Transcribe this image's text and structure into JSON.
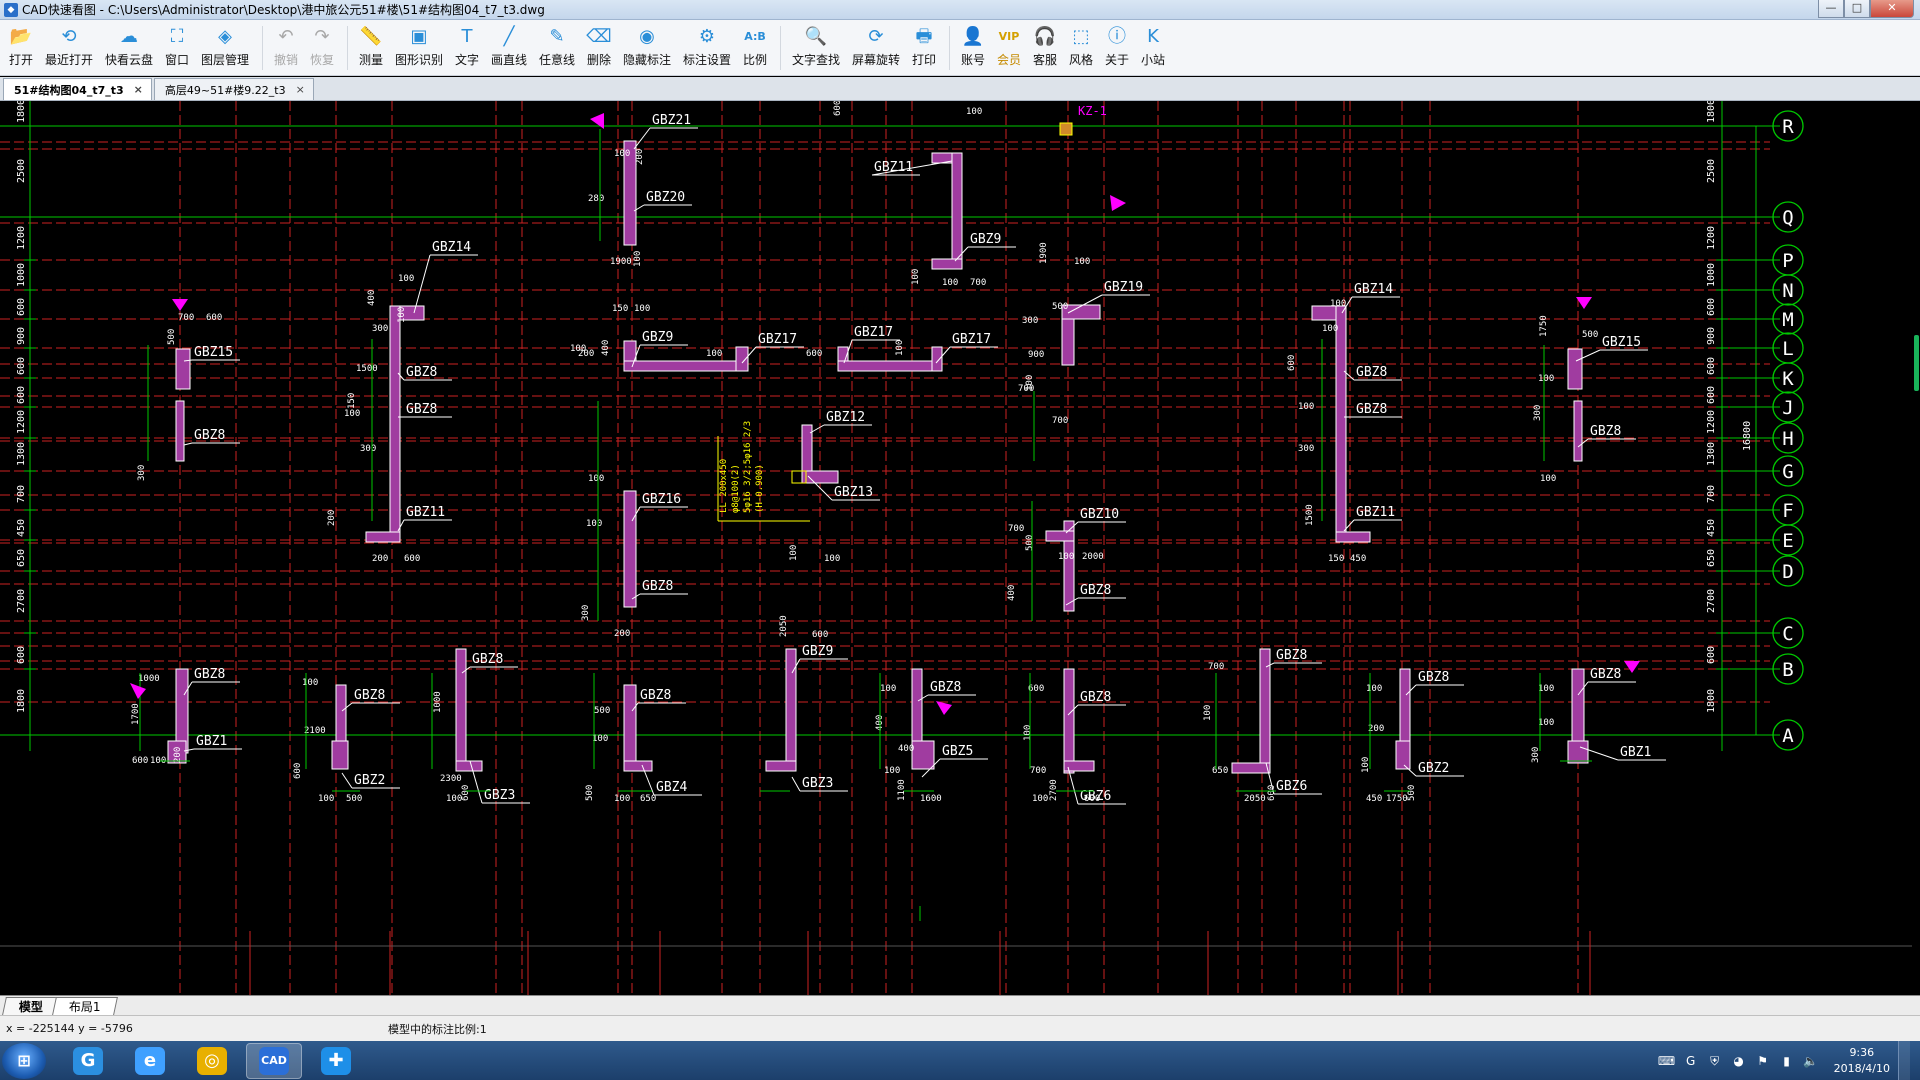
{
  "window": {
    "app_name": "CAD快速看图",
    "path": "C:\\Users\\Administrator\\Desktop\\港中旅公元51#楼\\51#结构图04_t7_t3.dwg",
    "minimize": "—",
    "maximize": "□",
    "close": "✕"
  },
  "toolbar": {
    "items": [
      {
        "label": "打开",
        "icon": "folder-open-icon",
        "glyph": "📂",
        "enabled": true
      },
      {
        "label": "最近打开",
        "icon": "history-icon",
        "glyph": "⟲",
        "enabled": true
      },
      {
        "label": "快看云盘",
        "icon": "cloud-icon",
        "glyph": "☁",
        "enabled": true
      },
      {
        "label": "窗口",
        "icon": "window-icon",
        "glyph": "⛶",
        "enabled": true
      },
      {
        "label": "图层管理",
        "icon": "layers-icon",
        "glyph": "◈",
        "enabled": true
      },
      {
        "label": "撤销",
        "icon": "undo-icon",
        "glyph": "↶",
        "enabled": false
      },
      {
        "label": "恢复",
        "icon": "redo-icon",
        "glyph": "↷",
        "enabled": false
      },
      {
        "label": "测量",
        "icon": "measure-icon",
        "glyph": "📏",
        "enabled": true
      },
      {
        "label": "图形识别",
        "icon": "shape-recognize-icon",
        "glyph": "▣",
        "enabled": true
      },
      {
        "label": "文字",
        "icon": "text-icon",
        "glyph": "T",
        "enabled": true
      },
      {
        "label": "画直线",
        "icon": "line-icon",
        "glyph": "╱",
        "enabled": true
      },
      {
        "label": "任意线",
        "icon": "freehand-icon",
        "glyph": "✎",
        "enabled": true
      },
      {
        "label": "删除",
        "icon": "eraser-icon",
        "glyph": "⌫",
        "enabled": true
      },
      {
        "label": "隐藏标注",
        "icon": "eye-hide-icon",
        "glyph": "◉",
        "enabled": true
      },
      {
        "label": "标注设置",
        "icon": "annotation-settings-icon",
        "glyph": "⚙",
        "enabled": true
      },
      {
        "label": "比例",
        "icon": "scale-icon",
        "glyph": "A:B",
        "enabled": true
      },
      {
        "label": "文字查找",
        "icon": "text-search-icon",
        "glyph": "🔍",
        "enabled": true
      },
      {
        "label": "屏幕旋转",
        "icon": "rotate-screen-icon",
        "glyph": "⟳",
        "enabled": true
      },
      {
        "label": "打印",
        "icon": "print-icon",
        "glyph": "🖶",
        "enabled": true
      },
      {
        "label": "账号",
        "icon": "account-icon",
        "glyph": "👤",
        "enabled": true
      },
      {
        "label": "会员",
        "icon": "vip-icon",
        "glyph": "VIP",
        "enabled": true,
        "vip": true
      },
      {
        "label": "客服",
        "icon": "headset-icon",
        "glyph": "🎧",
        "enabled": true
      },
      {
        "label": "风格",
        "icon": "style-icon",
        "glyph": "⬚",
        "enabled": true
      },
      {
        "label": "关于",
        "icon": "info-icon",
        "glyph": "ⓘ",
        "enabled": true
      },
      {
        "label": "小站",
        "icon": "station-icon",
        "glyph": "K",
        "enabled": true
      }
    ]
  },
  "tabs": [
    {
      "label": "51#结构图04_t7_t3",
      "active": true,
      "close": "×"
    },
    {
      "label": "高层49~51#楼9.22_t3",
      "active": false,
      "close": "×"
    }
  ],
  "layout_tabs": [
    {
      "label": "模型",
      "active": true
    },
    {
      "label": "布局1",
      "active": false
    }
  ],
  "status": {
    "coords": "x = -225144  y = -5796",
    "annotation_scale": "模型中的标注比例:1"
  },
  "taskbar": {
    "time": "9:36",
    "date": "2018/4/10",
    "apps": [
      {
        "name": "G",
        "icon": "g-app-icon",
        "color": "#2b8fe0",
        "active": false
      },
      {
        "name": "e",
        "icon": "ie-icon",
        "color": "#3fa0ff",
        "active": false
      },
      {
        "name": "◎",
        "icon": "chrome-icon",
        "color": "#e8b000",
        "active": false
      },
      {
        "name": "CAD",
        "icon": "cad-viewer-icon",
        "color": "#2b6fd8",
        "active": true
      },
      {
        "name": "✚",
        "icon": "app-plus-icon",
        "color": "#1e8fe8",
        "active": false
      }
    ]
  },
  "colors": {
    "canvas_bg": "#000000",
    "grid_line": "#cc2222",
    "axis_line": "#00c800",
    "wall": "#a03ca0",
    "wall_edge": "#ffffff",
    "marker": "#ff00ff",
    "label": "#ffffff",
    "dim_text": "#ffffff",
    "annotation": "#ffff00"
  },
  "drawing": {
    "axis_labels": [
      "R",
      "Q",
      "P",
      "N",
      "M",
      "L",
      "K",
      "J",
      "H",
      "G",
      "F",
      "E",
      "D",
      "C",
      "B",
      "A"
    ],
    "left_dims": [
      "1800",
      "2500",
      "1200",
      "1000",
      "600",
      "900",
      "600",
      "600",
      "1200",
      "1300",
      "700",
      "450",
      "650",
      "2700",
      "600",
      "1800"
    ],
    "right_dims": [
      "1800",
      "2500",
      "1200",
      "1000",
      "600",
      "900",
      "600",
      "600",
      "1200",
      "1300",
      "700",
      "450",
      "650",
      "2700",
      "600",
      "1800"
    ],
    "right_total": "16800",
    "kz_label": "KZ-1",
    "beam_note": [
      "LL 200x450",
      "φ8@100(2)",
      "5φ16 3/2;5φ16 2/3",
      "(H-0.900)"
    ],
    "wall_labels": [
      "GBZ21",
      "GBZ20",
      "GBZ11",
      "GBZ9",
      "GBZ14",
      "GBZ15",
      "GBZ8",
      "GBZ8",
      "GBZ11",
      "GBZ8",
      "GBZ9",
      "GBZ17",
      "GBZ17",
      "GBZ17",
      "GBZ19",
      "GBZ12",
      "GBZ13",
      "GBZ16",
      "GBZ8",
      "GBZ10",
      "GBZ8",
      "GBZ14",
      "GBZ8",
      "GBZ8",
      "GBZ11",
      "GBZ15",
      "GBZ8",
      "GBZ8",
      "GBZ1",
      "GBZ8",
      "GBZ2",
      "GBZ8",
      "GBZ3",
      "GBZ8",
      "GBZ4",
      "GBZ9",
      "GBZ3",
      "GBZ8",
      "GBZ5",
      "GBZ8",
      "GBZ6",
      "GBZ8",
      "GBZ6",
      "GBZ8",
      "GBZ2",
      "GBZ8",
      "GBZ1"
    ],
    "dims": [
      "600",
      "100",
      "100",
      "200",
      "280",
      "1900",
      "100",
      "150",
      "100",
      "100",
      "100",
      "700",
      "400",
      "100",
      "300",
      "100",
      "100",
      "700",
      "500",
      "600",
      "1500",
      "150",
      "300",
      "100",
      "200",
      "200",
      "600",
      "300",
      "100",
      "100",
      "300",
      "200",
      "200",
      "400",
      "100",
      "600",
      "100",
      "300",
      "900",
      "1900",
      "100",
      "500",
      "100",
      "700",
      "700",
      "100",
      "100",
      "700",
      "500",
      "100",
      "2000",
      "400",
      "100",
      "100",
      "600",
      "100",
      "300",
      "1500",
      "150",
      "450",
      "1750",
      "500",
      "100",
      "300",
      "100",
      "1000",
      "1700",
      "600",
      "100",
      "200",
      "100",
      "2100",
      "600",
      "100",
      "500",
      "1000",
      "2300",
      "100",
      "600",
      "500",
      "100",
      "500",
      "100",
      "650",
      "2050",
      "600",
      "100",
      "400",
      "100",
      "400",
      "1100",
      "1600",
      "600",
      "100",
      "700",
      "100",
      "2700",
      "600",
      "700",
      "100",
      "650",
      "2050",
      "600",
      "100",
      "200",
      "100",
      "450",
      "1750",
      "500",
      "100",
      "100",
      "300"
    ]
  }
}
